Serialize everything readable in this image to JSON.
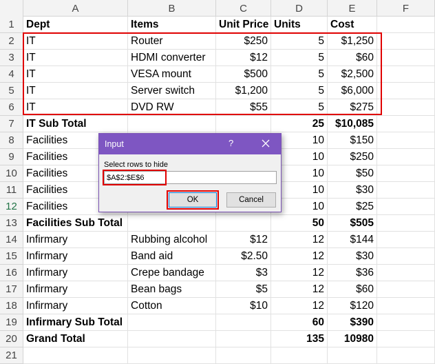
{
  "columns": [
    "A",
    "B",
    "C",
    "D",
    "E",
    "F"
  ],
  "rows": [
    {
      "num": "1",
      "cells": [
        "Dept",
        "Items",
        "Unit Price",
        "Units",
        "Cost",
        ""
      ],
      "bold": true,
      "header": true
    },
    {
      "num": "2",
      "cells": [
        "IT",
        "Router",
        "$250",
        "5",
        "$1,250",
        ""
      ]
    },
    {
      "num": "3",
      "cells": [
        "IT",
        "HDMI converter",
        "$12",
        "5",
        "$60",
        ""
      ]
    },
    {
      "num": "4",
      "cells": [
        "IT",
        "VESA mount",
        "$500",
        "5",
        "$2,500",
        ""
      ]
    },
    {
      "num": "5",
      "cells": [
        "IT",
        "Server switch",
        "$1,200",
        "5",
        "$6,000",
        ""
      ]
    },
    {
      "num": "6",
      "cells": [
        "IT",
        "DVD RW",
        "$55",
        "5",
        "$275",
        ""
      ]
    },
    {
      "num": "7",
      "cells": [
        "IT Sub Total",
        "",
        "",
        "25",
        "$10,085",
        ""
      ],
      "bold": true
    },
    {
      "num": "8",
      "cells": [
        "Facilities",
        "",
        "",
        "10",
        "$150",
        ""
      ]
    },
    {
      "num": "9",
      "cells": [
        "Facilities",
        "",
        "",
        "10",
        "$250",
        ""
      ]
    },
    {
      "num": "10",
      "cells": [
        "Facilities",
        "",
        "",
        "10",
        "$50",
        ""
      ]
    },
    {
      "num": "11",
      "cells": [
        "Facilities",
        "",
        "",
        "10",
        "$30",
        ""
      ]
    },
    {
      "num": "12",
      "cells": [
        "Facilities",
        "",
        "",
        "10",
        "$25",
        ""
      ]
    },
    {
      "num": "13",
      "cells": [
        "Facilities Sub Total",
        "",
        "",
        "50",
        "$505",
        ""
      ],
      "bold": true
    },
    {
      "num": "14",
      "cells": [
        "Infirmary",
        "Rubbing alcohol",
        "$12",
        "12",
        "$144",
        ""
      ]
    },
    {
      "num": "15",
      "cells": [
        "Infirmary",
        "Band aid",
        "$2.50",
        "12",
        "$30",
        ""
      ]
    },
    {
      "num": "16",
      "cells": [
        "Infirmary",
        "Crepe bandage",
        "$3",
        "12",
        "$36",
        ""
      ]
    },
    {
      "num": "17",
      "cells": [
        "Infirmary",
        "Bean bags",
        "$5",
        "12",
        "$60",
        ""
      ]
    },
    {
      "num": "18",
      "cells": [
        "Infirmary",
        "Cotton",
        "$10",
        "12",
        "$120",
        ""
      ]
    },
    {
      "num": "19",
      "cells": [
        "Infirmary Sub Total",
        "",
        "",
        "60",
        "$390",
        ""
      ],
      "bold": true
    },
    {
      "num": "20",
      "cells": [
        "Grand Total",
        "",
        "",
        "135",
        "10980",
        ""
      ],
      "bold": true
    },
    {
      "num": "21",
      "cells": [
        "",
        "",
        "",
        "",
        "",
        ""
      ]
    }
  ],
  "dialog": {
    "title": "Input",
    "help": "?",
    "label": "Select rows to hide",
    "value": "$A$2:$E$6",
    "ok": "OK",
    "cancel": "Cancel"
  },
  "colors": {
    "accent": "#7e56c2",
    "highlight": "#e00000"
  },
  "selected_row": "12"
}
